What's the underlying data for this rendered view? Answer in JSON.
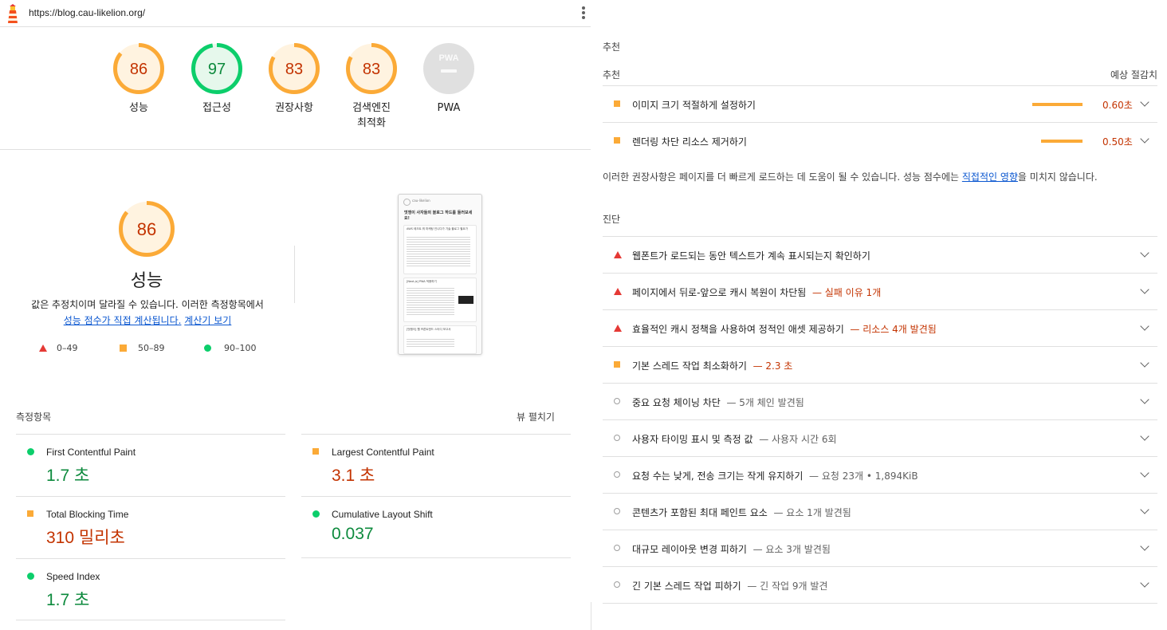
{
  "url": "https://blog.cau-likelion.org/",
  "colors": {
    "pass": "#0cce6b",
    "average": "#fbaa37",
    "fail": "#e53935",
    "link": "#0b57d0"
  },
  "gauges": [
    {
      "score": "86",
      "label": "성능",
      "status": "average"
    },
    {
      "score": "97",
      "label": "접근성",
      "status": "pass"
    },
    {
      "score": "83",
      "label": "권장사항",
      "status": "average"
    },
    {
      "score": "83",
      "label": "검색엔진\n최적화",
      "status": "average"
    },
    {
      "score": "PWA",
      "label": "PWA",
      "status": "na"
    }
  ],
  "performance": {
    "score": "86",
    "title": "성능",
    "desc_prefix": "값은 추정치이며 달라질 수 있습니다. 이러한 측정항목에서",
    "link1": "성능 점수가 직접 계산됩니다.",
    "link2": "계산기 보기",
    "legend": {
      "fail": "0–49",
      "average": "50–89",
      "pass": "90–100"
    }
  },
  "thumbnail": {
    "site": "cau-likelion",
    "heading": "멋쟁이 사자들의 블로그 하드를 둘러보세요!",
    "post1": "AWS 테크트 뭐 마케팅 인니다가 기술 블로그 필요가",
    "post2": "[Next.js] PWA 적용하기",
    "post3": "[멋쟁이] 웹 프론트엔드 스터디 보고서"
  },
  "metrics_header": "측정항목",
  "expand_view": "뷰 펼치기",
  "metrics": [
    {
      "name": "First Contentful Paint",
      "value": "1.7 초",
      "status": "pass"
    },
    {
      "name": "Largest Contentful Paint",
      "value": "3.1 초",
      "status": "average"
    },
    {
      "name": "Total Blocking Time",
      "value": "310 밀리초",
      "status": "average"
    },
    {
      "name": "Cumulative Layout Shift",
      "value": "0.037",
      "status": "pass"
    },
    {
      "name": "Speed Index",
      "value": "1.7 초",
      "status": "pass"
    }
  ],
  "opportunities": {
    "section_title": "추천",
    "col_left": "추천",
    "col_right": "예상 절감치",
    "items": [
      {
        "title": "이미지 크기 적절하게 설정하기",
        "saving": "0.60초",
        "bar_fraction": 0.6
      },
      {
        "title": "렌더링 차단 리소스 제거하기",
        "saving": "0.50초",
        "bar_fraction": 0.5
      }
    ],
    "advice_prefix": "이러한 권장사항은 페이지를 더 빠르게 로드하는 데 도움이 될 수 있습니다. 성능 점수에는 ",
    "advice_link": "직접적인 영향",
    "advice_suffix": "을 미치지 않습니다."
  },
  "diagnostics": {
    "section_title": "진단",
    "items": [
      {
        "title": "웹폰트가 로드되는 동안 텍스트가 계속 표시되는지 확인하기",
        "detail": "",
        "status": "fail"
      },
      {
        "title": "페이지에서 뒤로-앞으로 캐시 복원이 차단됨",
        "detail": "— 실패 이유 1개",
        "status": "fail"
      },
      {
        "title": "효율적인 캐시 정책을 사용하여 정적인 애셋 제공하기",
        "detail": "— 리소스 4개 발견됨",
        "status": "fail"
      },
      {
        "title": "기본 스레드 작업 최소화하기",
        "detail": "— 2.3 초",
        "status": "average"
      },
      {
        "title": "중요 요청 체이닝 차단",
        "detail": "— 5개 체인 발견됨",
        "status": "info"
      },
      {
        "title": "사용자 타이밍 표시 및 측정 값",
        "detail": "— 사용자 시간 6회",
        "status": "info"
      },
      {
        "title": "요청 수는 낮게, 전송 크기는 작게 유지하기",
        "detail": "— 요청 23개 • 1,894KiB",
        "status": "info"
      },
      {
        "title": "콘텐츠가 포함된 최대 페인트 요소",
        "detail": "— 요소 1개 발견됨",
        "status": "info"
      },
      {
        "title": "대규모 레이아웃 변경 피하기",
        "detail": "— 요소 3개 발견됨",
        "status": "info"
      },
      {
        "title": "긴 기본 스레드 작업 피하기",
        "detail": "— 긴 작업 9개 발견",
        "status": "info"
      }
    ]
  }
}
